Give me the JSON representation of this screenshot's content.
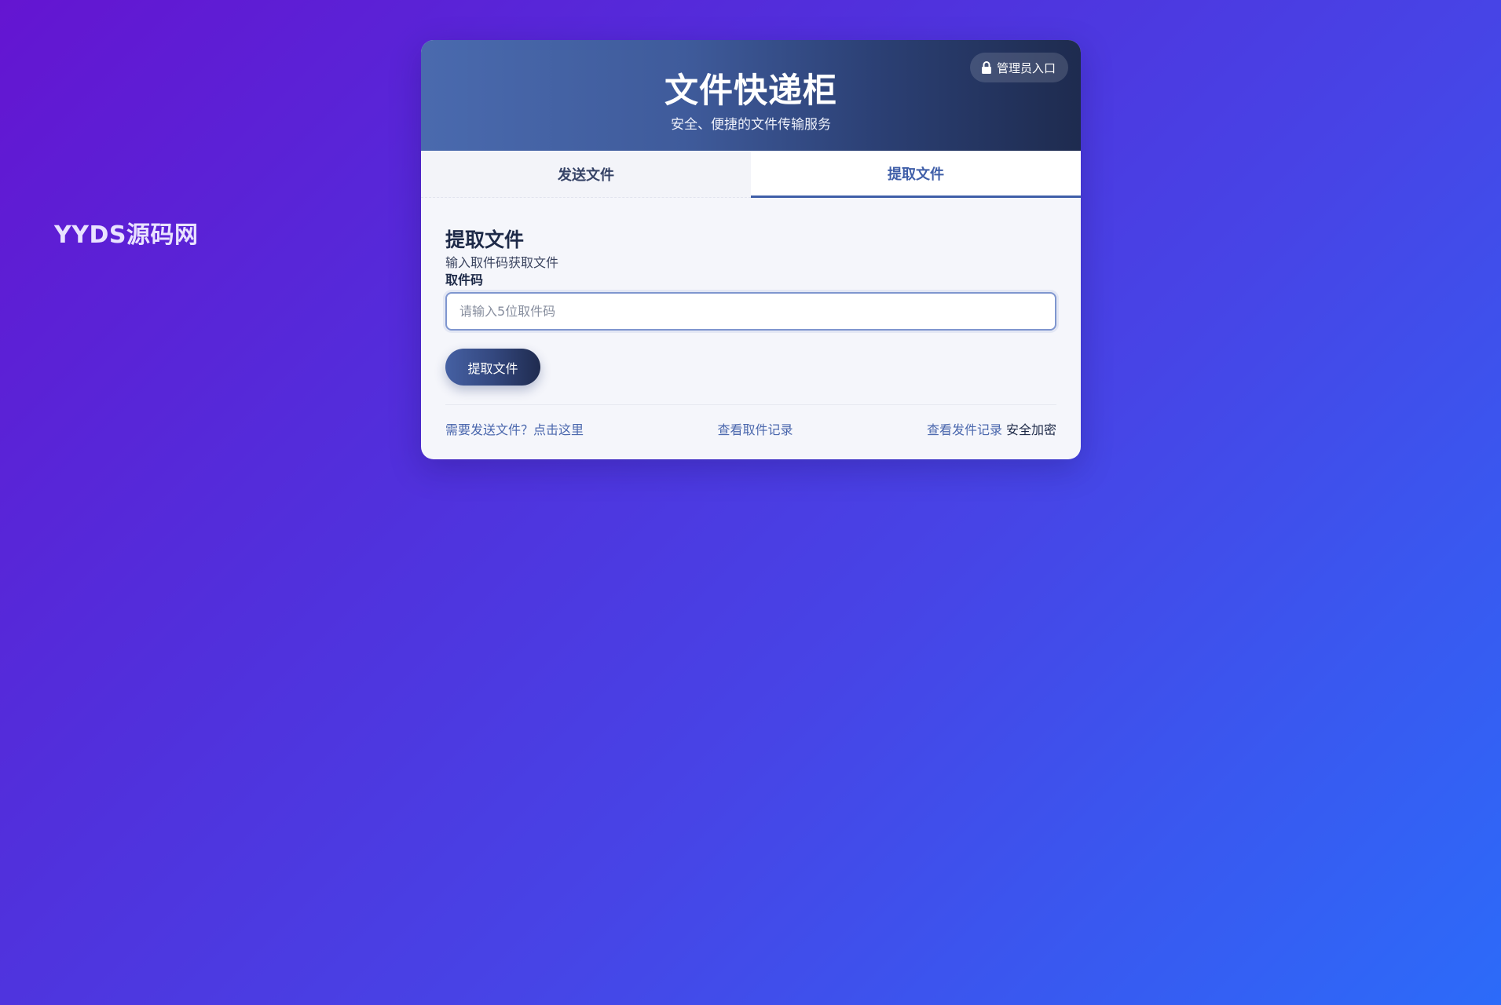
{
  "brand": {
    "text": "YYDS源码网"
  },
  "header": {
    "title": "文件快递柜",
    "subtitle": "安全、便捷的文件传输服务",
    "admin_label": "管理员入口",
    "admin_icon": "lock-icon"
  },
  "tabs": [
    {
      "label": "发送文件",
      "active": false
    },
    {
      "label": "提取文件",
      "active": true
    }
  ],
  "main": {
    "title": "提取文件",
    "description": "输入取件码获取文件",
    "field_label": "取件码",
    "input": {
      "value": "",
      "placeholder": "请输入5位取件码"
    },
    "submit_label": "提取文件"
  },
  "footer": {
    "send_link": "需要发送文件？点击这里",
    "pickup_records": "查看取件记录",
    "send_records": "查看发件记录",
    "secure_text": "安全加密"
  },
  "colors": {
    "accent": "#3f5ea8",
    "header_start": "#4a6aae",
    "header_end": "#1e2b4f",
    "background_start": "#6415d1",
    "background_end": "#2c6bf9"
  }
}
